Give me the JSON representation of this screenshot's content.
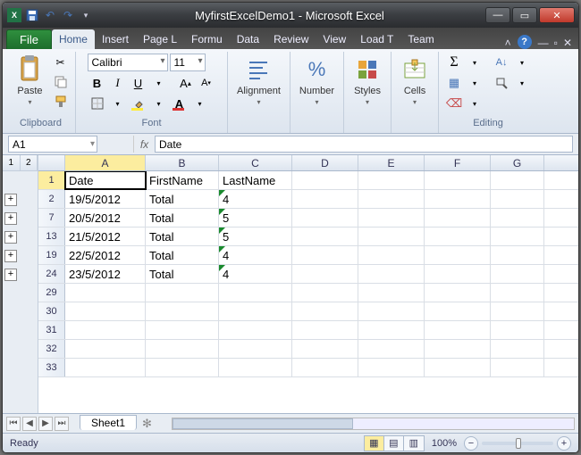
{
  "window": {
    "title": "MyfirstExcelDemo1 - Microsoft Excel"
  },
  "ribbon": {
    "file": "File",
    "tabs": [
      "Home",
      "Insert",
      "Page L",
      "Formu",
      "Data",
      "Review",
      "View",
      "Load T",
      "Team"
    ],
    "activeTab": "Home",
    "clipboardLabel": "Clipboard",
    "pasteLabel": "Paste",
    "fontLabel": "Font",
    "fontName": "Calibri",
    "fontSize": "11",
    "alignmentLabel": "Alignment",
    "numberLabel": "Number",
    "stylesLabel": "Styles",
    "cellsLabel": "Cells",
    "editingLabel": "Editing"
  },
  "namebox": "A1",
  "formula": "Date",
  "outline": {
    "levels": [
      "1",
      "2"
    ]
  },
  "columns": [
    "A",
    "B",
    "C",
    "D",
    "E",
    "F",
    "G"
  ],
  "rows": [
    {
      "num": "1",
      "A": "Date",
      "B": "FirstName",
      "C": "LastName",
      "tri": false,
      "active": true
    },
    {
      "num": "2",
      "A": "19/5/2012",
      "B": "Total",
      "C": "4",
      "tri": true
    },
    {
      "num": "7",
      "A": "20/5/2012",
      "B": "Total",
      "C": "5",
      "tri": true
    },
    {
      "num": "13",
      "A": "21/5/2012",
      "B": "Total",
      "C": "5",
      "tri": true
    },
    {
      "num": "19",
      "A": "22/5/2012",
      "B": "Total",
      "C": "4",
      "tri": true
    },
    {
      "num": "24",
      "A": "23/5/2012",
      "B": "Total",
      "C": "4",
      "tri": true
    },
    {
      "num": "29"
    },
    {
      "num": "30"
    },
    {
      "num": "31"
    },
    {
      "num": "32"
    },
    {
      "num": "33"
    }
  ],
  "sheet": {
    "tabs": [
      "Sheet1"
    ],
    "active": "Sheet1"
  },
  "status": {
    "ready": "Ready",
    "zoom": "100%"
  }
}
